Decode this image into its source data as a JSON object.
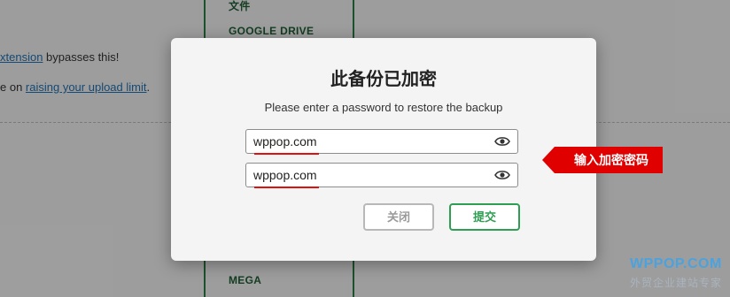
{
  "background": {
    "col_label_top": "文件",
    "col_label_gdrive": "GOOGLE DRIVE",
    "col_label_mega": "MEGA",
    "line1_link": "xtension",
    "line1_rest": " bypasses this!",
    "line2_prefix": "e on ",
    "line2_link": "raising your upload limit",
    "line2_suffix": "."
  },
  "dialog": {
    "title": "此备份已加密",
    "subtitle": "Please enter a password to restore the backup",
    "password_1": "wppop.com",
    "password_2": "wppop.com",
    "close_label": "关闭",
    "submit_label": "提交"
  },
  "annotation": {
    "label": "输入加密密码"
  },
  "watermark": {
    "brand": "WPPOP.COM",
    "tagline": "外贸企业建站专家"
  },
  "colors": {
    "accent_green": "#2e9e52",
    "annotation_red": "#e00000",
    "link_blue": "#2271b1"
  }
}
